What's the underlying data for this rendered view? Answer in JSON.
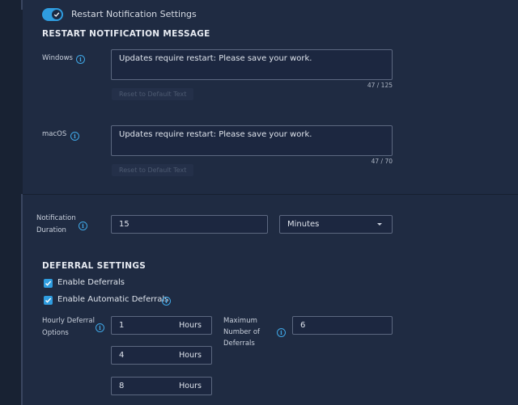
{
  "toggle": {
    "label": "Restart Notification Settings",
    "on": true
  },
  "restart_message": {
    "title": "RESTART NOTIFICATION MESSAGE",
    "windows": {
      "label": "Windows",
      "value": "Updates require restart: Please save your work.",
      "counter": "47 / 125",
      "reset_label": "Reset to Default Text"
    },
    "macos": {
      "label": "macOS",
      "value": "Updates require restart: Please save your work.",
      "counter": "47 / 70",
      "reset_label": "Reset to Default Text"
    }
  },
  "duration": {
    "label_line1": "Notification",
    "label_line2": "Duration",
    "value": "15",
    "unit_selected": "Minutes"
  },
  "deferral": {
    "title": "DEFERRAL SETTINGS",
    "enable_deferrals": {
      "label": "Enable Deferrals",
      "checked": true
    },
    "enable_auto": {
      "label": "Enable Automatic Deferrals",
      "checked": true
    },
    "hourly_label_line1": "Hourly Deferral",
    "hourly_label_line2": "Options",
    "hourly_options": [
      {
        "value": "1",
        "unit": "Hours"
      },
      {
        "value": "4",
        "unit": "Hours"
      },
      {
        "value": "8",
        "unit": "Hours"
      }
    ],
    "max_label_line1": "Maximum",
    "max_label_line2": "Number of",
    "max_label_line3": "Deferrals",
    "max_value": "6"
  },
  "colors": {
    "accent": "#2f9de0",
    "background": "#1f2b42"
  }
}
